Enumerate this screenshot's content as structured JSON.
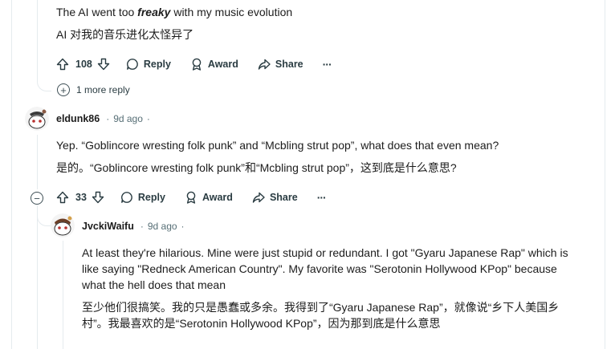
{
  "comment_top": {
    "text_en_prefix": "The AI went too ",
    "text_en_bold": "freaky",
    "text_en_suffix": " with my music evolution",
    "text_zh": "AI 对我的音乐进化太怪异了",
    "votes": "108",
    "reply_label": "Reply",
    "award_label": "Award",
    "share_label": "Share",
    "more_label": "···",
    "more_replies": "1 more reply"
  },
  "comment_eldunk": {
    "username": "eldunk86",
    "time": "9d ago",
    "dot": "·",
    "text_en": "Yep. “Goblincore wresting folk punk” and “Mcbling strut pop”, what does that even mean?",
    "text_zh": "是的。“Goblincore wresting folk punk”和“Mcbling strut pop”，这到底是什么意思?",
    "votes": "33",
    "reply_label": "Reply",
    "award_label": "Award",
    "share_label": "Share",
    "more_label": "···",
    "collapse_label": "−"
  },
  "comment_jvcki": {
    "username": "JvckiWaifu",
    "time": "9d ago",
    "dot": "·",
    "text_en": "At least they're hilarious. Mine were just stupid or redundant. I got \"Gyaru Japanese Rap\" which is like saying \"Redneck American Country\". My favorite was \"Serotonin Hollywood KPop\" because what the hell does that mean",
    "text_zh": "至少他们很搞笑。我的只是愚蠢或多余。我得到了“Gyaru Japanese Rap”，就像说“乡下人美国乡村”。我最喜欢的是“Serotonin Hollywood KPop”，因为那到底是什么意思"
  },
  "colors": {
    "text": "#1c1c1c",
    "meta": "#576f76",
    "rail": "#e5ebee",
    "icon": "#2a3c42"
  },
  "icons": [
    "upvote-icon",
    "downvote-icon",
    "comment-icon",
    "award-icon",
    "share-icon",
    "more-icon",
    "plus-circle-icon",
    "minus-circle-icon"
  ]
}
